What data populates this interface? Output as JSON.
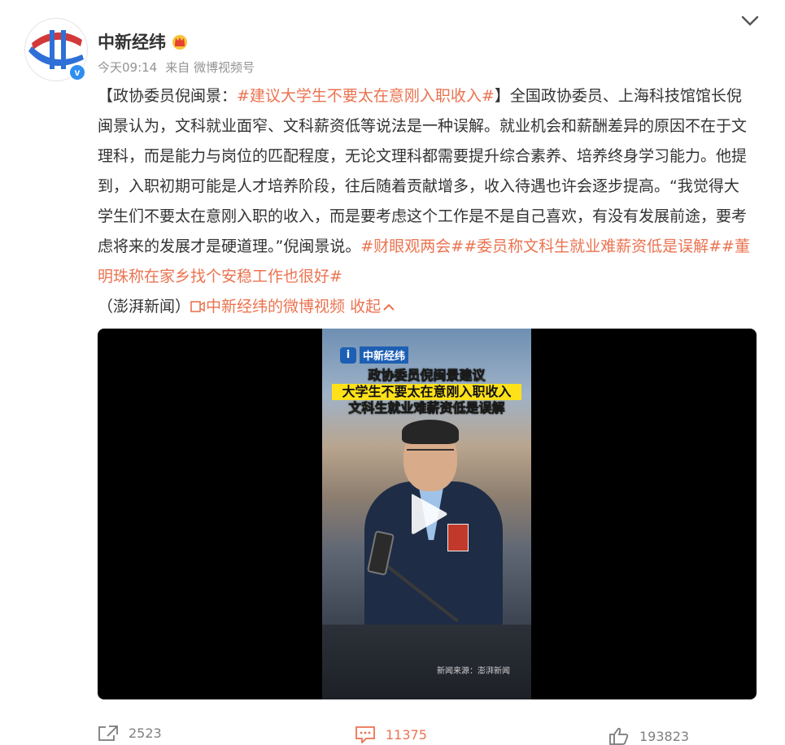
{
  "post": {
    "username": "中新经纬",
    "time": "今天09:14",
    "source_prefix": "来自",
    "source": "微博视频号",
    "content": {
      "lead_open": "【政协委员倪闽景：",
      "tag1": "#建议大学生不要太在意刚入职收入#",
      "body": "】全国政协委员、上海科技馆馆长倪闽景认为，文科就业面窄、文科薪资低等说法是一种误解。就业机会和薪酬差异的原因不在于文理科，而是能力与岗位的匹配程度，无论文理科都需要提升综合素养、培养终身学习能力。他提到，入职初期可能是人才培养阶段，往后随着贡献增多，收入待遇也许会逐步提高。“我觉得大学生们不要太在意刚入职的收入，而是要考虑这个工作是不是自己喜欢，有没有发展前途，要考虑将来的发展才是硬道理。”倪闽景说。",
      "tag2": "#财眼观两会#",
      "tag3": "#委员称文科生就业难薪资低是误解#",
      "tag4": "#董明珠称在家乡找个安稳工作也很好#",
      "credit": "（澎湃新闻）",
      "video_link": "中新经纬的微博视频",
      "collapse": "收起"
    },
    "video": {
      "brand": "中新经纬",
      "headline1": "政协委员倪闽景建议",
      "headline2": "大学生不要太在意刚入职收入",
      "headline3": "文科生就业难薪资低是误解",
      "source": "新闻来源：澎湃新闻"
    },
    "actions": {
      "forward": "2523",
      "comment": "11375",
      "like": "193823"
    }
  },
  "colors": {
    "accent": "#eb7350",
    "verified": "#2e8ef0",
    "meta": "#939393"
  },
  "icons": [
    "chevron-down-icon",
    "crown-icon",
    "verified-icon",
    "play-icon",
    "forward-icon",
    "comment-icon",
    "like-icon",
    "video-link-icon",
    "chevron-up-icon"
  ]
}
